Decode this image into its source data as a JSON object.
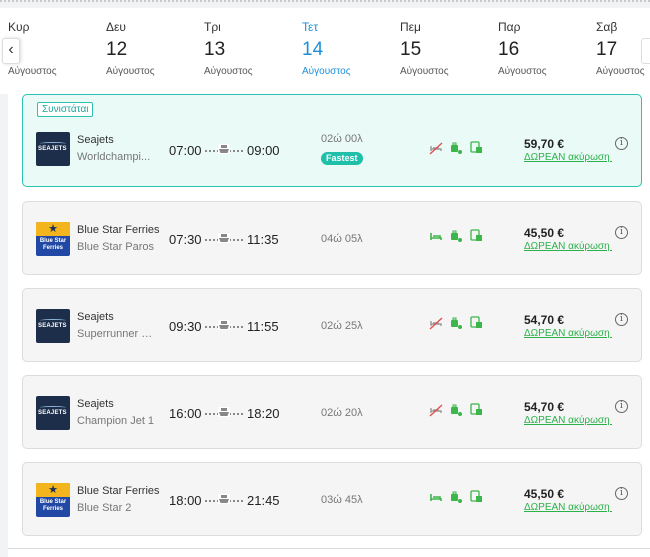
{
  "dates": [
    {
      "day": "Κυρ",
      "num": "",
      "month": "Αύγουστος"
    },
    {
      "day": "Δευ",
      "num": "12",
      "month": "Αύγουστος"
    },
    {
      "day": "Τρι",
      "num": "13",
      "month": "Αύγουστος"
    },
    {
      "day": "Τετ",
      "num": "14",
      "month": "Αύγουστος"
    },
    {
      "day": "Πεμ",
      "num": "15",
      "month": "Αύγουστος"
    },
    {
      "day": "Παρ",
      "num": "16",
      "month": "Αύγουστος"
    },
    {
      "day": "Σαβ",
      "num": "17",
      "month": "Αύγουστος"
    }
  ],
  "selected_date": "Τετ 14",
  "nav": {
    "prev_icon": "chevron-left-icon",
    "next_icon": "chevron-right-icon"
  },
  "colors": {
    "accent": "#1d8fd6",
    "recommended": "#2cc1b0",
    "free_cancel": "#2bb04a"
  },
  "trips": [
    {
      "badge": "Συνιστάται",
      "operator": "Seajets",
      "vessel": "Worldchampi...",
      "logo": "seajets",
      "depart": "07:00",
      "arrive": "09:00",
      "duration": "02ώ 00λ",
      "tag": "Fastest",
      "amenities": [
        "no-bed-icon",
        "luggage-icon",
        "pet-icon"
      ],
      "price": "59,70 €",
      "cancel": "ΔΩΡΕΑΝ ακύρωση έω..."
    },
    {
      "operator": "Blue Star Ferries",
      "vessel": "Blue Star Paros",
      "logo": "bluestar",
      "depart": "07:30",
      "arrive": "11:35",
      "duration": "04ώ 05λ",
      "amenities": [
        "bed-icon",
        "luggage-icon",
        "pet-icon"
      ],
      "price": "45,50 €",
      "cancel": "ΔΩΡΕΑΝ ακύρωση έω..."
    },
    {
      "operator": "Seajets",
      "vessel": "Superrunner Jet",
      "logo": "seajets",
      "depart": "09:30",
      "arrive": "11:55",
      "duration": "02ώ 25λ",
      "amenities": [
        "no-bed-icon",
        "luggage-icon",
        "pet-icon"
      ],
      "price": "54,70 €",
      "cancel": "ΔΩΡΕΑΝ ακύρωση έω..."
    },
    {
      "operator": "Seajets",
      "vessel": "Champion Jet 1",
      "logo": "seajets",
      "depart": "16:00",
      "arrive": "18:20",
      "duration": "02ώ 20λ",
      "amenities": [
        "no-bed-icon",
        "luggage-icon",
        "pet-icon"
      ],
      "price": "54,70 €",
      "cancel": "ΔΩΡΕΑΝ ακύρωση έω..."
    },
    {
      "operator": "Blue Star Ferries",
      "vessel": "Blue Star 2",
      "logo": "bluestar",
      "depart": "18:00",
      "arrive": "21:45",
      "duration": "03ώ 45λ",
      "amenities": [
        "bed-icon",
        "luggage-icon",
        "pet-icon"
      ],
      "price": "45,50 €",
      "cancel": "ΔΩΡΕΑΝ ακύρωση έω..."
    }
  ],
  "logo_text": {
    "seajets": "SEAJETS",
    "bluestar": "Blue Star Ferries",
    "star": "★"
  },
  "info_icon": "i"
}
